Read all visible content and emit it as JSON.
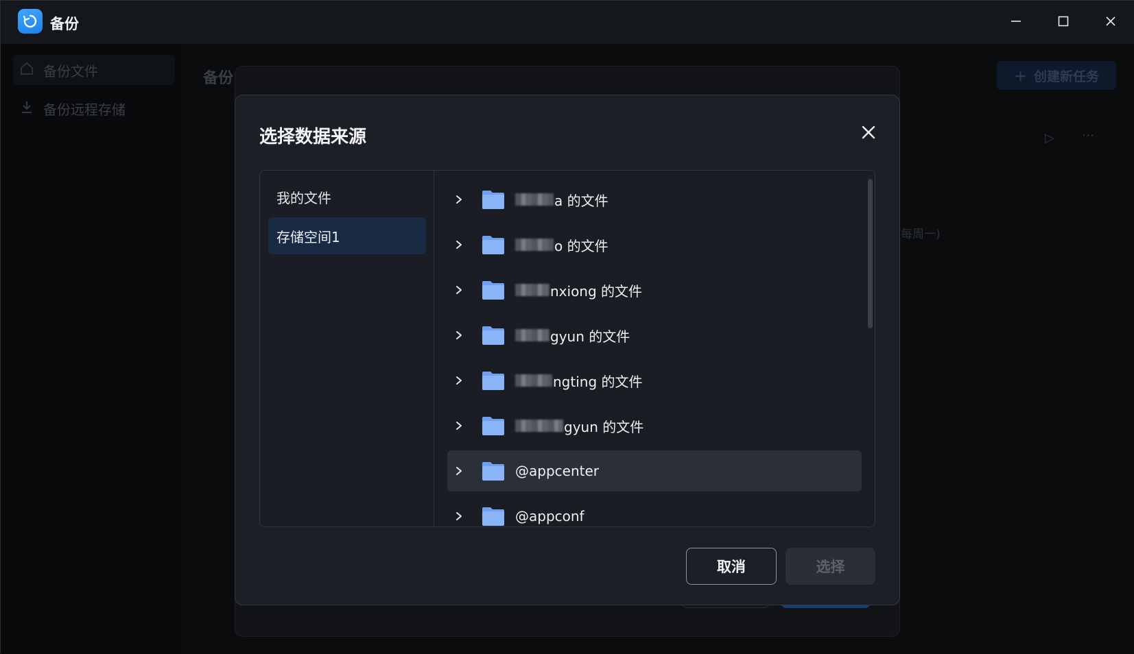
{
  "app": {
    "title": "备份"
  },
  "background": {
    "sidebar": [
      {
        "label": "备份文件"
      },
      {
        "label": "备份远程存储"
      }
    ],
    "page_title": "备份",
    "create_button": "创建新任务",
    "schedule_hint": "每周一)"
  },
  "dialog": {
    "title": "选择数据来源",
    "sources": [
      {
        "label": "我的文件"
      },
      {
        "label": "存储空间1"
      }
    ],
    "folders": [
      {
        "prefix_blur": 56,
        "name": "a 的文件"
      },
      {
        "prefix_blur": 56,
        "name": "o 的文件"
      },
      {
        "prefix_blur": 50,
        "name": "nxiong 的文件"
      },
      {
        "prefix_blur": 50,
        "name": "gyun 的文件"
      },
      {
        "prefix_blur": 54,
        "name": "ngting 的文件"
      },
      {
        "prefix_blur": 70,
        "name": "gyun 的文件"
      },
      {
        "prefix_blur": 0,
        "name": "@appcenter"
      },
      {
        "prefix_blur": 0,
        "name": "@appconf"
      }
    ],
    "cancel_label": "取消",
    "select_label": "选择"
  },
  "colors": {
    "accent": "#2e8bff",
    "selected_source": "#182a44",
    "folder": "#8ab4f8"
  }
}
